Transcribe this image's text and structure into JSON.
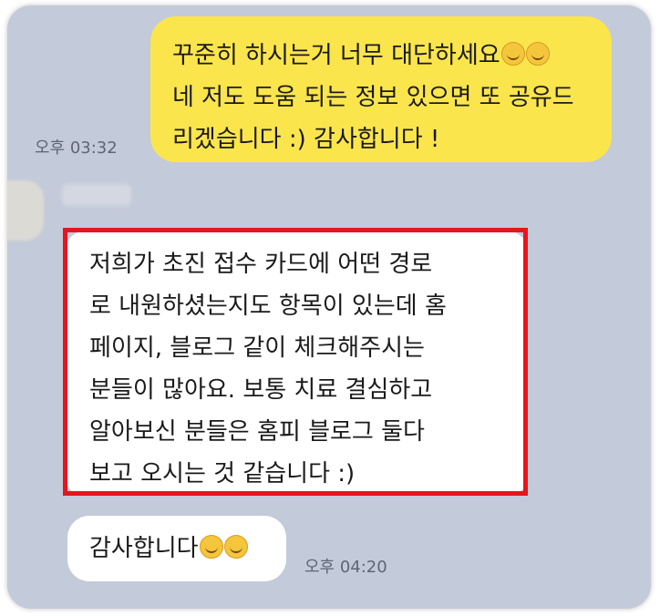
{
  "messages": {
    "outgoing": {
      "lines": [
        "꾸준히 하시는거 너무 대단하세요",
        "네 저도 도움 되는 정보 있으면 또 공유드",
        "리겠습니다 :) 감사합니다 !"
      ],
      "emoji": "relieved-face-emoji",
      "time": "오후 03:32"
    },
    "incoming": {
      "lines": [
        "저희가 초진 접수 카드에 어떤 경로",
        "로 내원하셨는지도 항목이 있는데 홈",
        "페이지, 블로그 같이 체크해주시는",
        "분들이 많아요. 보통 치료 결심하고",
        "알아보신 분들은 홈피 블로그 둘다",
        "보고 오시는 것 같습니다 :)"
      ],
      "highlight_color": "#e8151c"
    },
    "incoming_short": {
      "text": "감사합니다",
      "emoji": "smiling-face-emoji",
      "time": "오후 04:20"
    }
  },
  "colors": {
    "chat_background": "#c3cad9",
    "outgoing_bubble": "#fbe54d",
    "incoming_bubble": "#ffffff"
  }
}
